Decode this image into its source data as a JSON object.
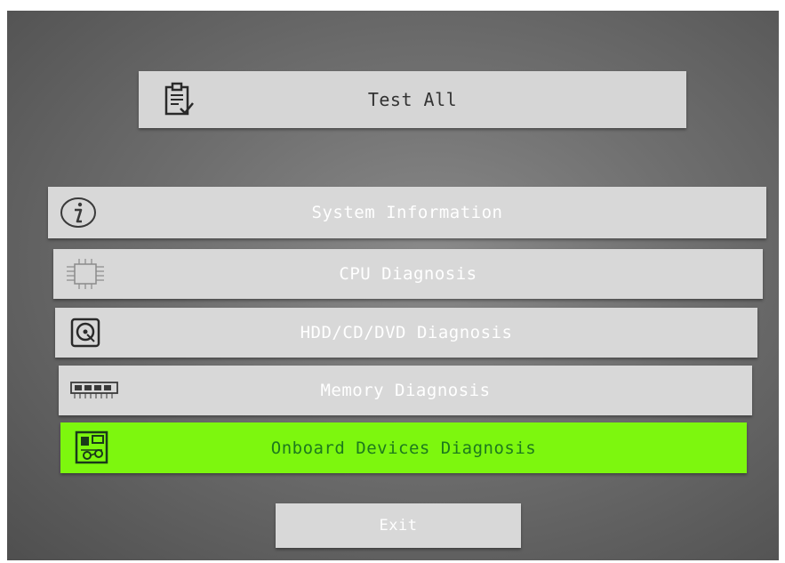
{
  "menu": {
    "test_all": {
      "label": "Test All",
      "icon": "clipboard-check-icon"
    },
    "items": [
      {
        "label": "System Information",
        "icon": "info-icon"
      },
      {
        "label": "CPU Diagnosis",
        "icon": "cpu-chip-icon"
      },
      {
        "label": "HDD/CD/DVD Diagnosis",
        "icon": "hard-disk-icon"
      },
      {
        "label": "Memory Diagnosis",
        "icon": "memory-module-icon"
      },
      {
        "label": "Onboard Devices Diagnosis",
        "icon": "circuit-board-icon",
        "selected": true
      }
    ],
    "exit": {
      "label": "Exit"
    }
  },
  "colors": {
    "selected_background": "#7df70e",
    "selected_text": "#1d7a1d",
    "button_background": "#d8d8d8",
    "button_text": "#ffffff"
  }
}
